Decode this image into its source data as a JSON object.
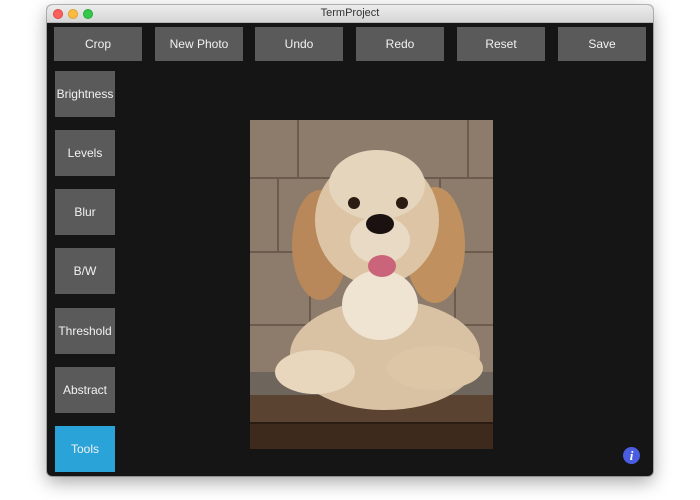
{
  "window": {
    "title": "TermProject"
  },
  "toolbar": {
    "buttons": [
      "Crop",
      "New Photo",
      "Undo",
      "Redo",
      "Reset",
      "Save"
    ]
  },
  "sidebar": {
    "buttons": [
      "Brightness",
      "Levels",
      "Blur",
      "B/W",
      "Threshold",
      "Abstract",
      "Tools"
    ],
    "active": "Tools"
  },
  "info": {
    "label": "i"
  },
  "colors": {
    "background": "#151515",
    "button": "#5a5a5a",
    "active_button": "#2aa3d8",
    "info_button": "#4a5de0"
  }
}
